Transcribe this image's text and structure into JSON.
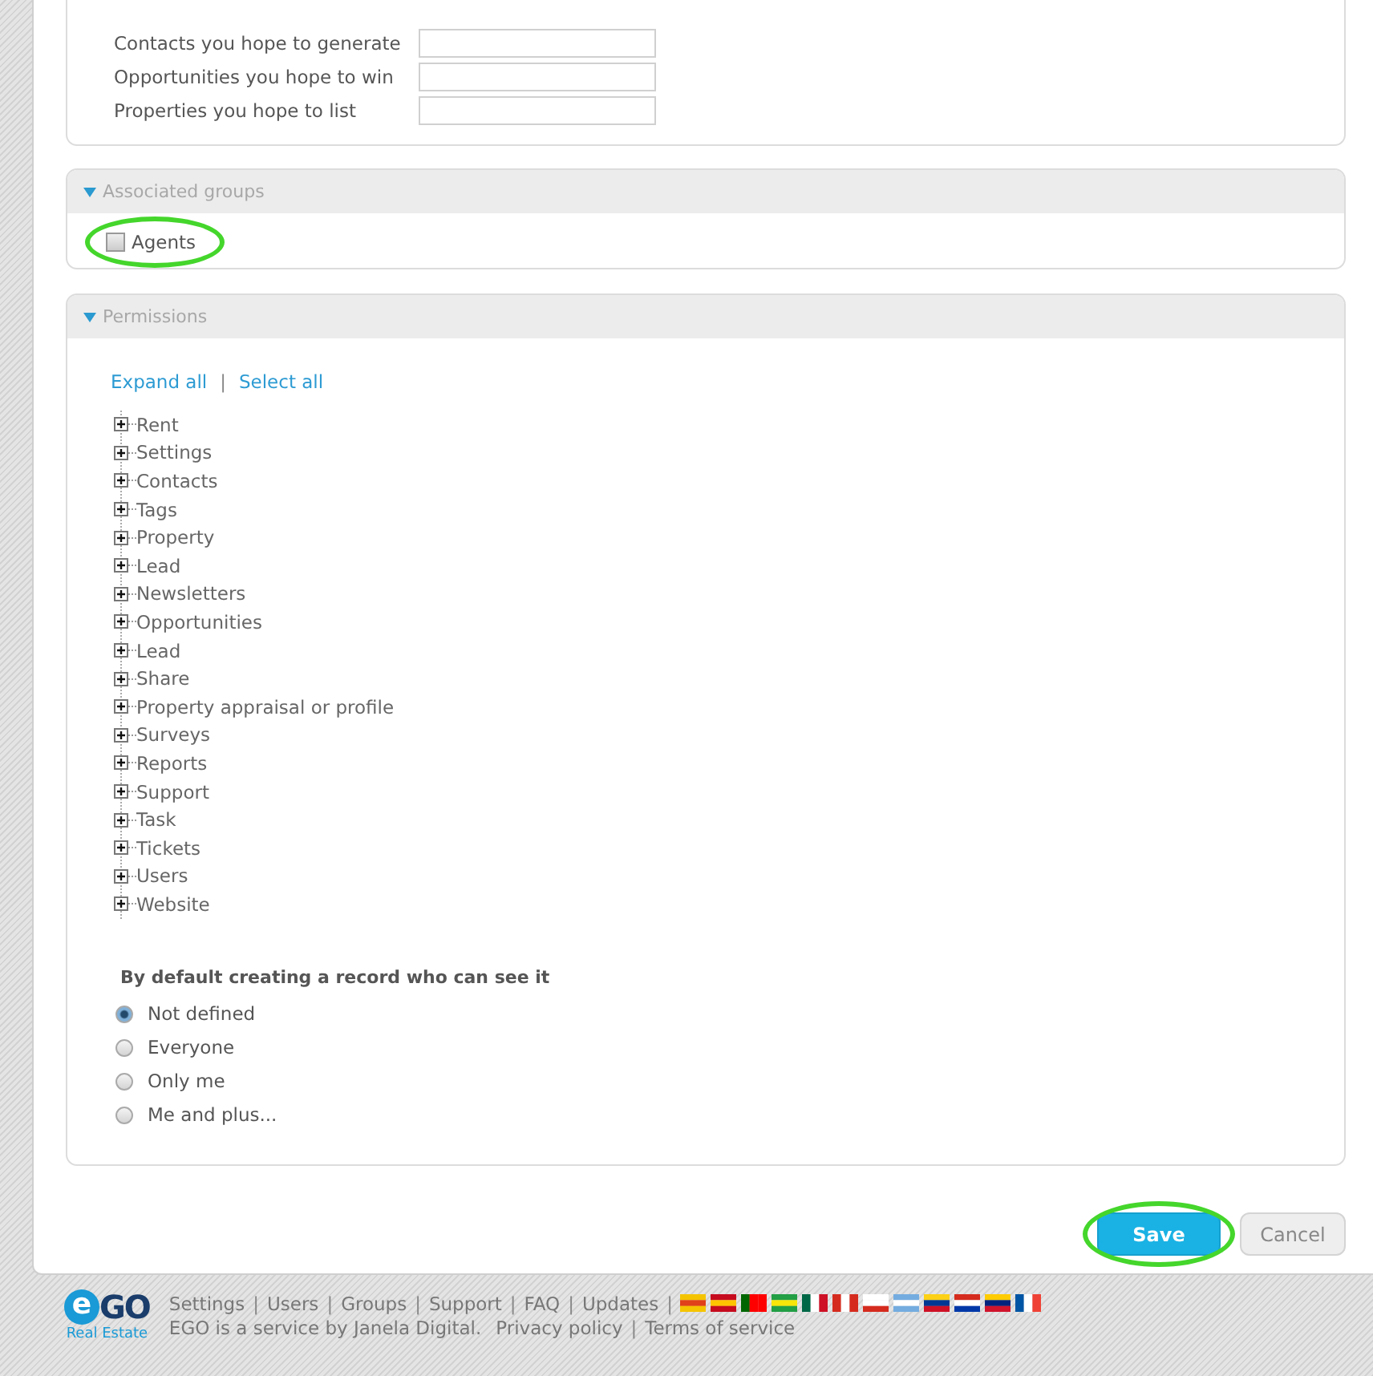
{
  "goals": {
    "fields": [
      {
        "label": "Contacts you hope to generate"
      },
      {
        "label": "Opportunities you hope to win"
      },
      {
        "label": "Properties you hope to list"
      }
    ]
  },
  "associated_groups": {
    "title": "Associated groups",
    "expanded": true,
    "groups": [
      {
        "label": "Agents",
        "checked": false,
        "highlighted": true
      }
    ]
  },
  "permissions": {
    "title": "Permissions",
    "expanded": true,
    "links": [
      "Expand all",
      "Select all"
    ],
    "link_separator": "|",
    "tree": [
      {
        "label": "Rent",
        "expanded": false
      },
      {
        "label": "Settings",
        "expanded": false
      },
      {
        "label": "Contacts",
        "expanded": false
      },
      {
        "label": "Tags",
        "expanded": false
      },
      {
        "label": "Property",
        "expanded": false
      },
      {
        "label": "Lead",
        "expanded": false
      },
      {
        "label": "Newsletters",
        "expanded": false
      },
      {
        "label": "Opportunities",
        "expanded": false
      },
      {
        "label": "Lead",
        "expanded": false
      },
      {
        "label": "Share",
        "expanded": false
      },
      {
        "label": "Property appraisal or profile",
        "expanded": false
      },
      {
        "label": "Surveys",
        "expanded": false
      },
      {
        "label": "Reports",
        "expanded": false
      },
      {
        "label": "Support",
        "expanded": false
      },
      {
        "label": "Task",
        "expanded": false
      },
      {
        "label": "Tickets",
        "expanded": false
      },
      {
        "label": "Users",
        "expanded": false
      },
      {
        "label": "Website",
        "expanded": false
      }
    ],
    "visibility_heading": "By default creating a record who can see it",
    "visibility_options": [
      {
        "label": "Not defined",
        "selected": true
      },
      {
        "label": "Everyone",
        "selected": false
      },
      {
        "label": "Only me",
        "selected": false
      },
      {
        "label": "Me and plus...",
        "selected": false
      }
    ]
  },
  "buttons": [
    {
      "label": "Save",
      "kind": "primary",
      "highlighted": true
    },
    {
      "label": "Cancel",
      "kind": "secondary",
      "highlighted": false
    }
  ],
  "footer": {
    "logo": {
      "text": "GO",
      "initial": "e",
      "tagline": "Real Estate"
    },
    "links": [
      "Settings",
      "Users",
      "Groups",
      "Support",
      "FAQ",
      "Updates"
    ],
    "separator": "|",
    "credit": "EGO is a service by Janela Digital.",
    "legal_links": [
      "Privacy policy",
      "Terms of service"
    ]
  }
}
